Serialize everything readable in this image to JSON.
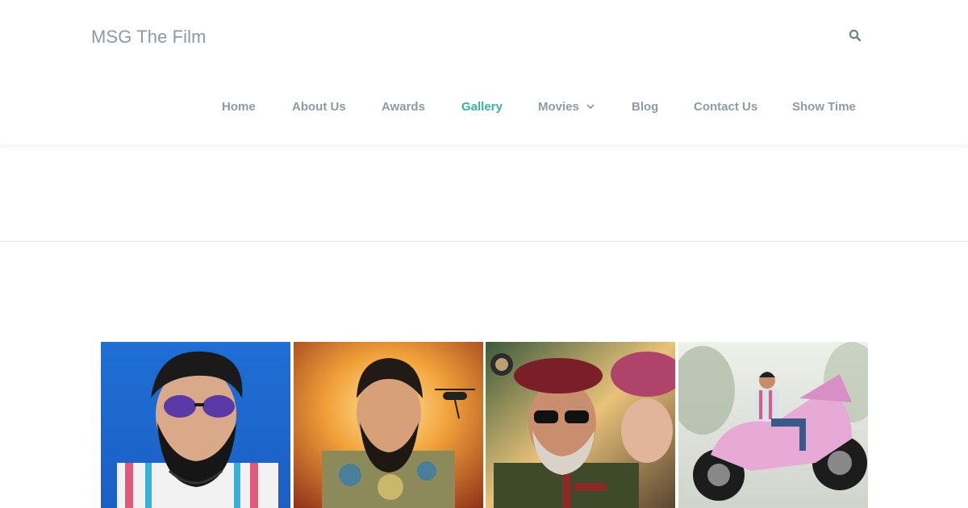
{
  "site": {
    "title": "MSG The Film"
  },
  "header": {
    "search_icon": "search-icon"
  },
  "nav": {
    "items": [
      {
        "label": "Home"
      },
      {
        "label": "About Us"
      },
      {
        "label": "Awards"
      },
      {
        "label": "Gallery",
        "active": true
      },
      {
        "label": "Movies",
        "has_dropdown": true
      },
      {
        "label": "Blog"
      },
      {
        "label": "Contact Us"
      },
      {
        "label": "Show Time"
      }
    ],
    "active_color": "#33b3a6",
    "text_color": "#8e9ba7"
  },
  "gallery": {
    "images": [
      {
        "subject": "man with beard and purple sunglasses on blue background"
      },
      {
        "subject": "man in patterned shirt with fiery explosion and helicopter"
      },
      {
        "subject": "commando in maroon beret and sunglasses with soldier"
      },
      {
        "subject": "man riding pink motorcycle"
      }
    ]
  }
}
